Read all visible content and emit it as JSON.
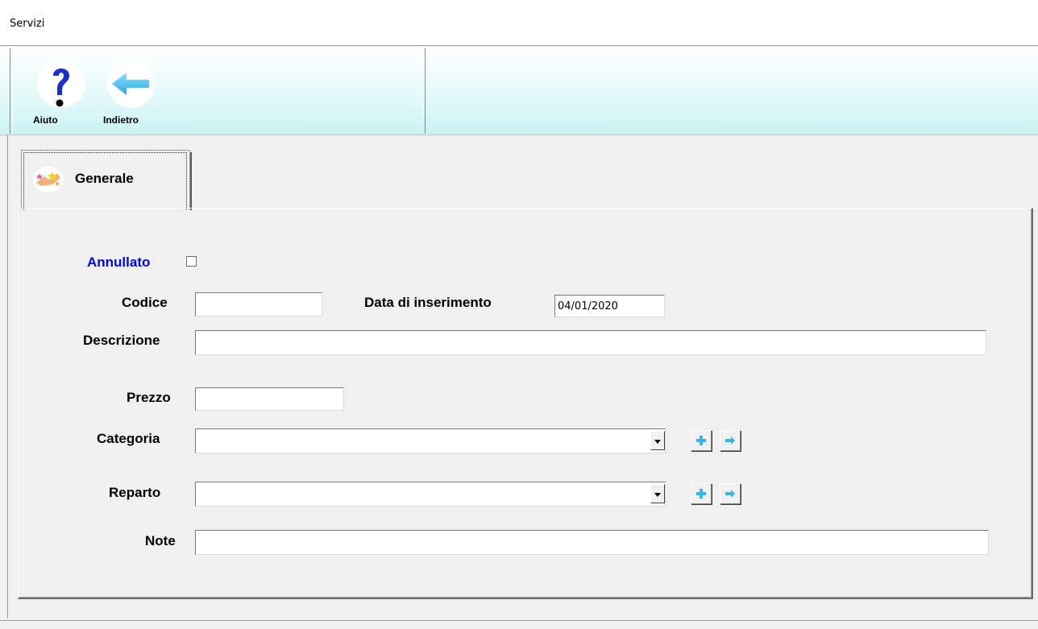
{
  "window": {
    "title": "Servizi"
  },
  "toolbar": {
    "help_label": "Aiuto",
    "back_label": "Indietro"
  },
  "tabs": [
    {
      "label": "Generale",
      "selected": true
    }
  ],
  "form": {
    "annullato": {
      "label": "Annullato",
      "checked": false
    },
    "codice": {
      "label": "Codice",
      "value": ""
    },
    "data_inserimento": {
      "label": "Data di inserimento",
      "value": "04/01/2020"
    },
    "descrizione": {
      "label": "Descrizione",
      "value": ""
    },
    "prezzo": {
      "label": "Prezzo",
      "value": ""
    },
    "categoria": {
      "label": "Categoria",
      "selected": ""
    },
    "reparto": {
      "label": "Reparto",
      "selected": ""
    },
    "note": {
      "label": "Note",
      "value": ""
    }
  },
  "colors": {
    "link_blue": "#0000ff",
    "toolbar_teal": "#ccf2f4",
    "icon_blue": "#3ab4e8",
    "help_blue": "#1a2fd0"
  },
  "icons": {
    "help": "question-mark-icon",
    "back": "left-arrow-icon",
    "tab": "stars-icon",
    "add": "plus-icon",
    "go": "right-arrow-icon"
  }
}
